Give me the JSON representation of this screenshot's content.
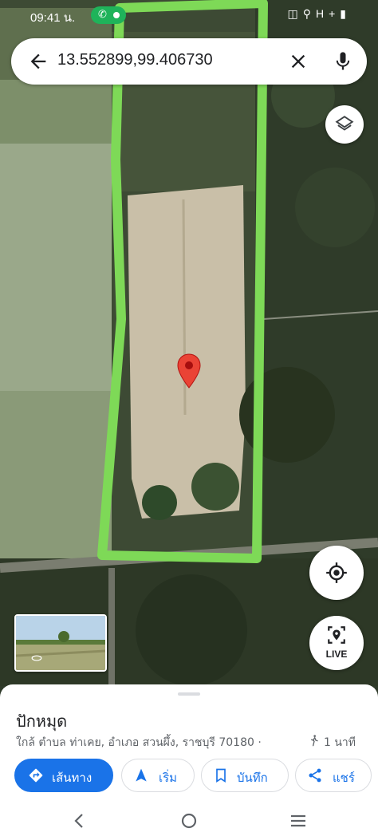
{
  "status_bar": {
    "time": "09:41 น.",
    "network": "H+"
  },
  "search": {
    "query": "13.552899,99.406730"
  },
  "map": {
    "marker": "red-location-pin",
    "highlight_color": "#7ed957",
    "buttons": {
      "live_label": "LIVE"
    }
  },
  "place": {
    "title": "ปักหมุด",
    "subtitle": "ใกล้ ตำบล ท่าเคย, อำเภอ สวนผึ้ง, ราชบุรี 70180 ·",
    "walk_time": "1 นาที"
  },
  "actions": [
    {
      "label": "เส้นทาง",
      "icon": "directions-icon"
    },
    {
      "label": "เริ่ม",
      "icon": "navigate-arrow-icon"
    },
    {
      "label": "บันทึก",
      "icon": "bookmark-icon"
    },
    {
      "label": "แชร์",
      "icon": "share-icon"
    }
  ],
  "colors": {
    "accent": "#1a73e8",
    "pin": "#ea4335"
  }
}
